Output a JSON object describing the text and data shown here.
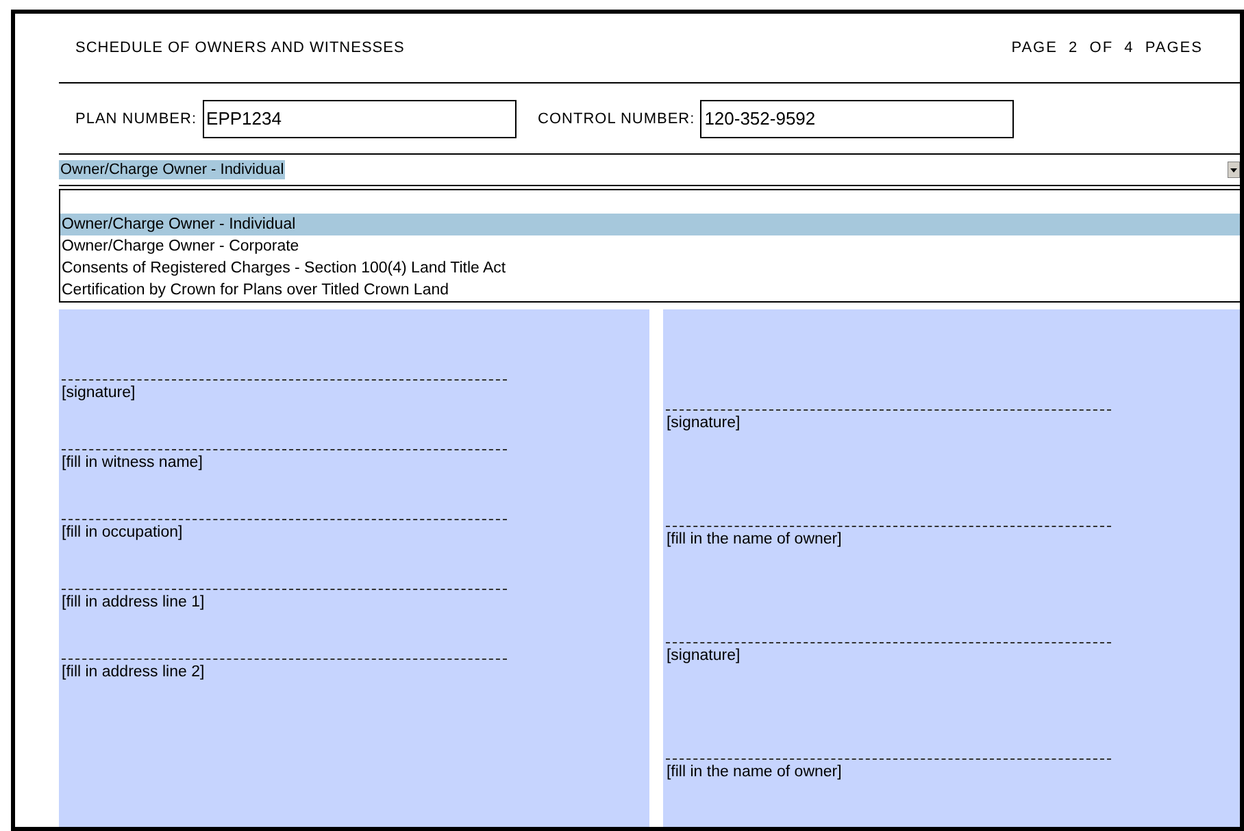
{
  "header": {
    "title": "SCHEDULE OF OWNERS AND WITNESSES",
    "page": "PAGE  2  OF  4  PAGES"
  },
  "fields": [
    {
      "label": "PLAN NUMBER:",
      "value": "EPP1234"
    },
    {
      "label": "CONTROL NUMBER:",
      "value": "120-352-9592"
    }
  ],
  "dropdown": {
    "value": "Owner/Charge Owner - Individual",
    "expanded": true,
    "options": [
      {
        "label": "Owner/Charge Owner - Individual",
        "selected": true
      },
      {
        "label": "Owner/Charge Owner - Corporate",
        "selected": false
      },
      {
        "label": "Consents of Registered Charges - Section 100(4) Land Title Act",
        "selected": false
      },
      {
        "label": "Certification by Crown for Plans over Titled Crown Land",
        "selected": false
      }
    ]
  },
  "panels": [
    {
      "lines": [
        "[signature]",
        "[fill in witness name]",
        "[fill in occupation]",
        "[fill in address line 1]",
        "[fill in address line 2]"
      ]
    },
    {
      "lines": [
        "[signature]",
        "[fill in the name of owner]",
        "[signature]",
        "[fill in the name of owner]"
      ]
    }
  ]
}
